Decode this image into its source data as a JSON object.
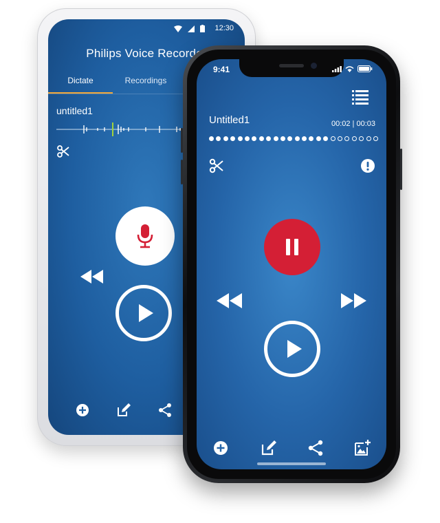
{
  "android": {
    "status_time": "12:30",
    "app_title": "Philips Voice Recorder",
    "tabs": [
      {
        "label": "Dictate",
        "active": true
      },
      {
        "label": "Recordings",
        "active": false
      }
    ],
    "recording_name": "untitled1",
    "accent_color": "#f2a93b",
    "record_button_color": "#d41f35",
    "bottom_icons": [
      "add-icon",
      "edit-icon",
      "share-icon"
    ]
  },
  "iphone": {
    "status_time": "9:41",
    "recording_name": "Untitled1",
    "elapsed": "00:02",
    "separator": "|",
    "total": "00:03",
    "progress": {
      "filled_dots": 17,
      "total_dots": 24
    },
    "pause_button_color": "#d41f35",
    "bottom_icons": [
      "add-icon",
      "edit-icon",
      "share-icon",
      "add-image-icon"
    ]
  }
}
